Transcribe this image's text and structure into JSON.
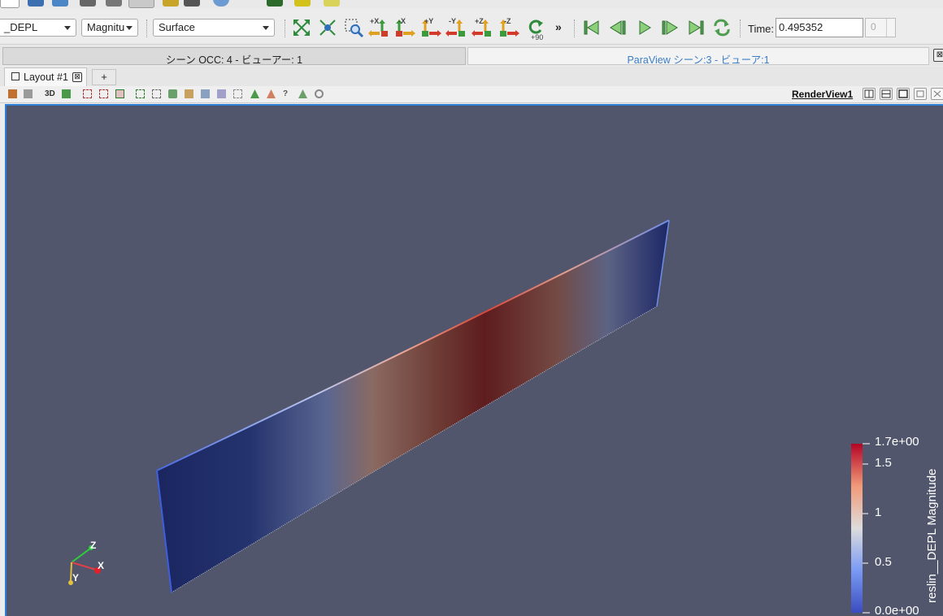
{
  "toolbar": {
    "array_combo": "_DEPL",
    "component_combo": "Magnitu",
    "representation_combo": "Surface",
    "camera_labels": [
      "+X",
      "-X",
      "+Y",
      "-Y",
      "+Z",
      "-Z"
    ],
    "rotate_label": "+90",
    "more_label": "»",
    "time_label": "Time:",
    "time_value": "0.495352",
    "time_index": "0"
  },
  "view_tabs": [
    {
      "label": "シーン OCC: 4 - ビューアー: 1"
    },
    {
      "label": "ParaView シーン:3 - ビューア:1"
    }
  ],
  "view_tab_close": "⊠",
  "layout_tab": {
    "label": "Layout #1",
    "close": "⊠",
    "add": "+"
  },
  "render_view": {
    "name": "RenderView1",
    "mode_3d": "3D"
  },
  "colorbar": {
    "title": "reslin__DEPL Magnitude",
    "max_label": "1.7e+00",
    "ticks": [
      "1.5",
      "1",
      "0.5"
    ],
    "min_label": "0.0e+00"
  },
  "axes_widget": {
    "x": "X",
    "y": "Y",
    "z": "Z"
  },
  "colors": {
    "background": "#51566c",
    "selection_border": "#2f7fd6",
    "active_tab_text": "#3a7ec8"
  }
}
